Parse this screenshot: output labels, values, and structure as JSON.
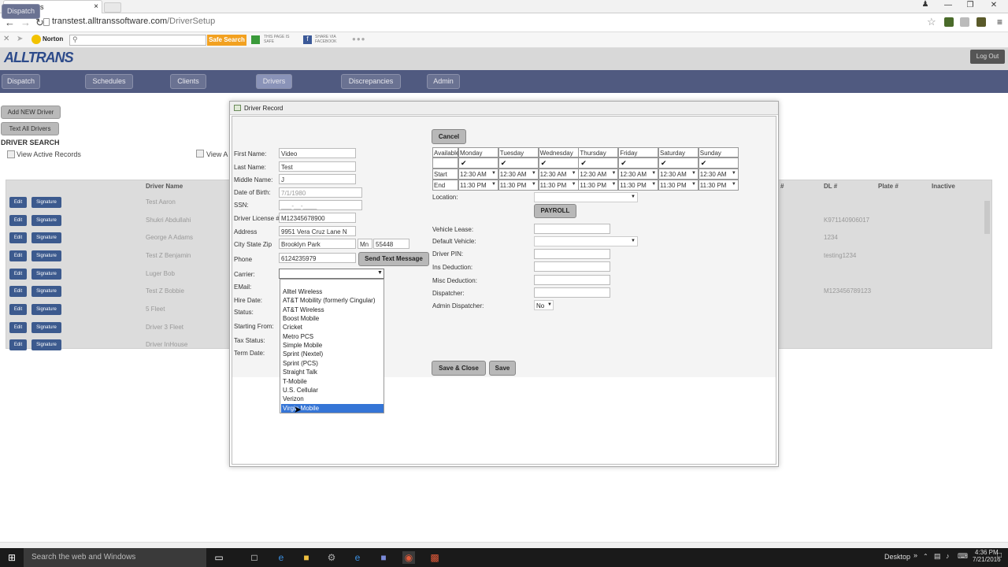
{
  "browser": {
    "tab_title": "Drivers",
    "tab_close": "×",
    "url_host": "transtest.alltranssoftware.com",
    "url_path": "/DriverSetup",
    "norton_label": "Norton",
    "safe_search_label": "Safe Search",
    "page_safe_label": "THIS PAGE IS SAFE",
    "share_label": "SHARE VIA FACEBOOK"
  },
  "app": {
    "logo_text": "ALLTRANS",
    "logout_label": "Log Out",
    "nav": [
      {
        "label": "Dispatch"
      },
      {
        "label": "Schedules"
      },
      {
        "label": "Clients"
      },
      {
        "label": "Drivers"
      },
      {
        "label": "Discrepancies"
      },
      {
        "label": "Admin"
      }
    ],
    "add_driver_label": "Add NEW Driver",
    "text_all_label": "Text All Drivers",
    "driver_search_label": "DRIVER SEARCH",
    "view_active_label": "View Active Records",
    "view_all_label": "View A",
    "grid_headers": {
      "name": "Driver Name",
      "num": "#",
      "dl": "DL #",
      "plate": "Plate #",
      "inactive": "Inactive"
    },
    "edit_label": "Edit",
    "signature_label": "Signature",
    "rows": [
      {
        "name": "Test Aaron",
        "dl": ""
      },
      {
        "name": "Shukri Abdullahi",
        "dl": "K971140906017"
      },
      {
        "name": "George A Adams",
        "dl": "1234"
      },
      {
        "name": "Test Z Benjamin",
        "dl": "testing1234"
      },
      {
        "name": "Luger Bob",
        "dl": ""
      },
      {
        "name": "Test Z Bobbie",
        "dl": "M123456789123"
      },
      {
        "name": "5 Fleet",
        "dl": ""
      },
      {
        "name": "Driver 3 Fleet",
        "dl": ""
      },
      {
        "name": "Driver InHouse",
        "dl": ""
      }
    ]
  },
  "dialog": {
    "title": "Driver Record",
    "labels": {
      "first_name": "First Name:",
      "last_name": "Last Name:",
      "middle_name": "Middle Name:",
      "dob": "Date of Birth:",
      "ssn": "SSN:",
      "license": "Driver License #",
      "address": "Address",
      "city": "City State Zip",
      "phone": "Phone",
      "carrier": "Carrier:",
      "email": "EMail:",
      "hire_date": "Hire Date:",
      "status": "Status:",
      "starting_from": "Starting From:",
      "tax_status": "Tax Status:",
      "term_date": "Term Date:"
    },
    "values": {
      "first_name": "Video",
      "last_name": "Test",
      "middle_name": "J",
      "dob": "7/1/1980",
      "ssn": "___-__-____",
      "license": "M12345678900",
      "address": "9951 Vera Cruz Lane N",
      "city": "Brooklyn Park",
      "state": "Mn",
      "zip": "55448",
      "phone": "6124235979"
    },
    "send_text_label": "Send Text Message",
    "cancel_label": "Cancel",
    "schedule": {
      "available_label": "Available",
      "days": [
        "Monday",
        "Tuesday",
        "Wednesday",
        "Thursday",
        "Friday",
        "Saturday",
        "Sunday"
      ],
      "start_label": "Start",
      "end_label": "End",
      "start_time": "12:30 AM",
      "end_time": "11:30 PM"
    },
    "right_labels": {
      "location": "Location:",
      "vehicle_lease": "Vehicle Lease:",
      "default_vehicle": "Default Vehicle:",
      "driver_pin": "Driver PIN:",
      "ins_deduction": "Ins Deduction:",
      "misc_deduction": "Misc Deduction:",
      "dispatcher": "Dispatcher:",
      "admin_dispatcher": "Admin Dispatcher:"
    },
    "payroll_label": "PAYROLL",
    "admin_dispatcher_value": "No",
    "save_close_label": "Save & Close",
    "save_label": "Save",
    "carrier_options": [
      "Alltel Wireless",
      "AT&T Mobility (formerly Cingular)",
      "AT&T Wireless",
      "Boost Mobile",
      "Cricket",
      "Metro PCS",
      "Simple Mobile",
      "Sprint (Nextel)",
      "Sprint (PCS)",
      "Straight Talk",
      "T-Mobile",
      "U.S. Cellular",
      "Verizon",
      "Virgin Mobile"
    ],
    "carrier_selected_index": 13
  },
  "taskbar": {
    "search_placeholder": "Search the web and Windows",
    "desktop_label": "Desktop",
    "time": "4:36 PM",
    "date": "7/21/2016"
  },
  "colors": {
    "navbar": "#505a80",
    "accent_selected": "#3575d6",
    "button_blue": "#3c5a8e"
  }
}
